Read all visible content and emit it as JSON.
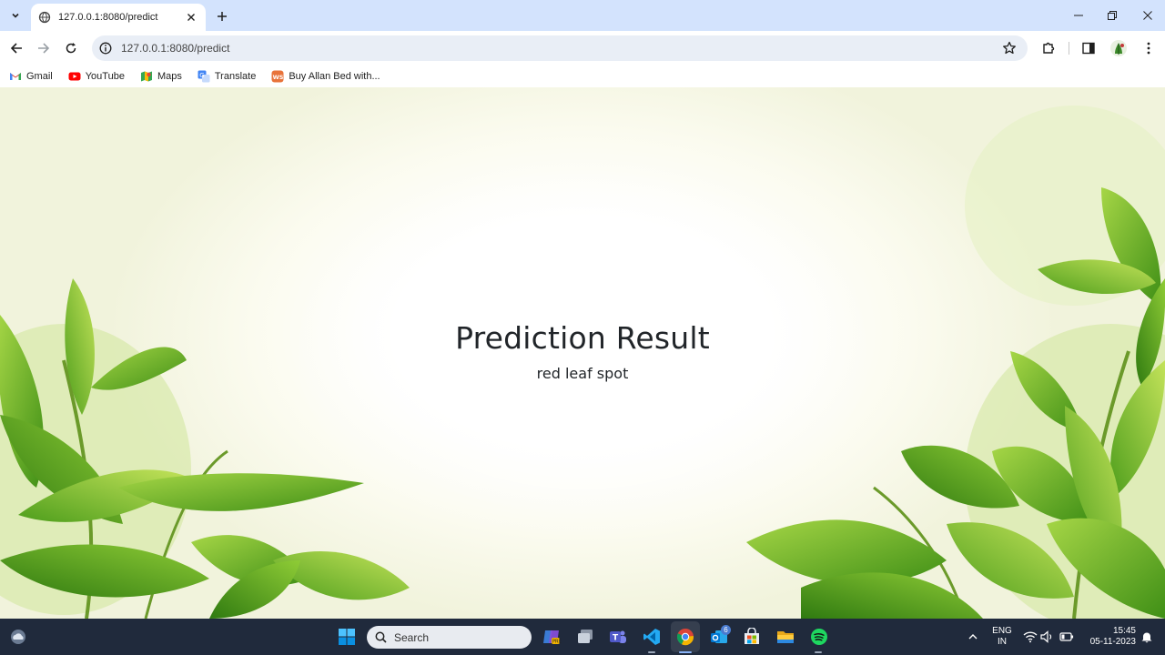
{
  "browser": {
    "tab_title": "127.0.0.1:8080/predict",
    "url": "127.0.0.1:8080/predict",
    "bookmarks": [
      {
        "label": "Gmail",
        "icon": "gmail-icon"
      },
      {
        "label": "YouTube",
        "icon": "youtube-icon"
      },
      {
        "label": "Maps",
        "icon": "maps-icon"
      },
      {
        "label": "Translate",
        "icon": "translate-icon"
      },
      {
        "label": "Buy Allan Bed with...",
        "icon": "ws-icon"
      }
    ]
  },
  "page": {
    "title": "Prediction Result",
    "result": "red leaf spot"
  },
  "taskbar": {
    "search_label": "Search",
    "language_line1": "ENG",
    "language_line2": "IN",
    "time": "15:45",
    "date": "05-11-2023",
    "outlook_badge": "6"
  },
  "colors": {
    "titlebar": "#d3e3fd",
    "omnibox": "#e9eef6",
    "taskbar": "#202a3c",
    "heading": "#212529",
    "leaf": "#5fae1f"
  }
}
